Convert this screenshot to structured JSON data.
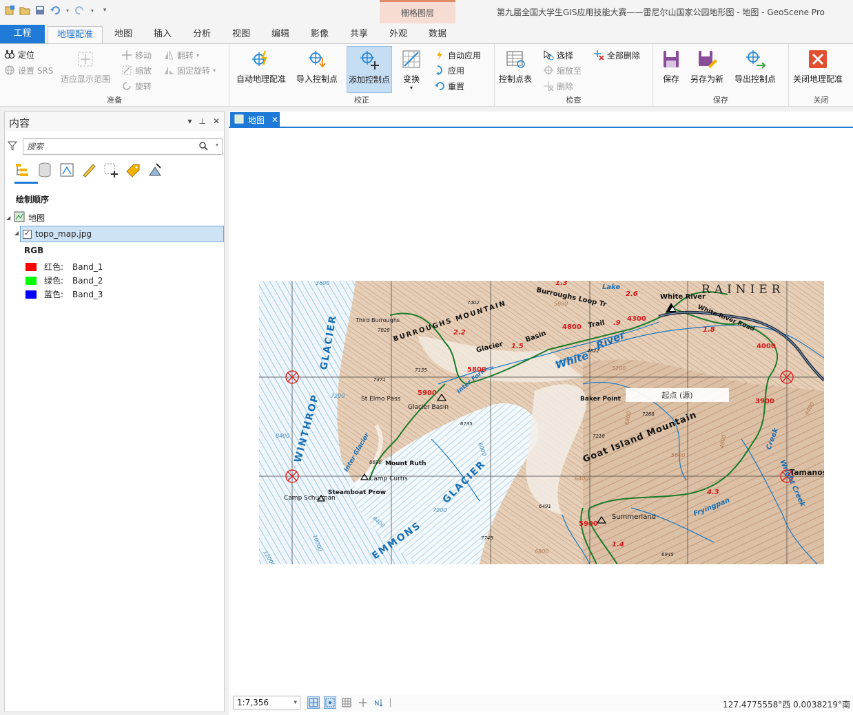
{
  "titlebar": {
    "app_title": "第九届全国大学生GIS应用技能大赛——雷尼尔山国家公园地形图 - 地图 - GeoScene Pro",
    "context_tab": "栅格图层"
  },
  "tabs": [
    {
      "label": "工程"
    },
    {
      "label": "地理配准"
    },
    {
      "label": "地图"
    },
    {
      "label": "插入"
    },
    {
      "label": "分析"
    },
    {
      "label": "视图"
    },
    {
      "label": "编辑"
    },
    {
      "label": "影像"
    },
    {
      "label": "共享"
    },
    {
      "label": "外观"
    },
    {
      "label": "数据"
    }
  ],
  "ribbon": {
    "prepare": {
      "label": "准备",
      "locate": "定位",
      "set_srs": "设置 SRS",
      "fit_extent": "适应显示范围",
      "move": "移动",
      "scale": "缩放",
      "rotate": "旋转",
      "flip": "翻转",
      "fixed_rotate": "固定旋转"
    },
    "adjust": {
      "label": "校正",
      "auto_georef": "自动地理配准",
      "import_cp": "导入控制点",
      "add_cp": "添加控制点",
      "transform": "变换",
      "auto_apply": "自动应用",
      "apply": "应用",
      "reset": "重置"
    },
    "review": {
      "label": "检查",
      "cp_table": "控制点表",
      "select": "选择",
      "zoom_to": "缩放至",
      "delete": "删除",
      "delete_all": "全部删除"
    },
    "save": {
      "label": "保存",
      "save": "保存",
      "save_as": "另存为新",
      "export_cp": "导出控制点"
    },
    "close": {
      "label": "关闭",
      "close_georef": "关闭地理配准"
    }
  },
  "contents": {
    "title": "内容",
    "search_placeholder": "搜索",
    "draw_order": "绘制顺序",
    "map_name": "地图",
    "layer_name": "topo_map.jpg",
    "renderer": "RGB",
    "bands": [
      {
        "channel": "红色:",
        "band": "Band_1",
        "color": "#ff0000"
      },
      {
        "channel": "绿色:",
        "band": "Band_2",
        "color": "#00ff00"
      },
      {
        "channel": "蓝色:",
        "band": "Band_3",
        "color": "#0000ff"
      }
    ]
  },
  "mapview": {
    "tab_label": "地图",
    "scale": "1:7,356",
    "coords": "127.4775558°西 0.0038219°南",
    "map_labels": {
      "rainier": "RAINIER",
      "white_river": "White River",
      "white_river_road": "White River Road",
      "burroughs_mountain": "BURROUGHS MOUNTAIN",
      "glacier_basin_trail": "Glacier Basin Trail",
      "burroughs_loop": "Burroughs Loop Tr",
      "winthrop": "WINTHROP",
      "glacier": "GLACIER",
      "emmons": "EMMONS",
      "emmons_glacier": "GLACIER",
      "goat_island": "Goat Island Mountain",
      "baker_point": "Baker Point",
      "white": "White",
      "river": "River",
      "inter_fork": "Inter Fork",
      "inter_glacier": "Inter Glacier",
      "st_elmo": "St Elmo Pass",
      "glacier_basin": "Glacier Basin",
      "mount_ruth": "Mount Ruth",
      "camp_curtis": "Camp Curtis",
      "steamboat_prow": "Steamboat Prow",
      "camp_schurman": "Camp Schurman",
      "summerland": "Summerland",
      "fryingpan": "Fryingpan",
      "creek": "Creek",
      "wright_creek": "Wright Creek",
      "tamanos": "Tamanos Mt",
      "third_burroughs": "Third Burroughs",
      "lake": "Lake",
      "trail": "Trail",
      "basin": "Basin",
      "glacier_word": "Glacier",
      "source_label": "起点 (源)",
      "elev_5900": "5900",
      "elev_4800": "4800",
      "elev_4300": "4300",
      "elev_4000": "4000",
      "elev_3900": "3900",
      "elev_5800": "5800",
      "elev_5900b": "5900",
      "dist_2_2": "2.2",
      "dist_1_5": "1.5",
      "dist_2_6": "2.6",
      "dist_1_8": "1.8",
      "dist_4_3": "4.3",
      "dist_1_4": "1.4",
      "dist_1_3": "1.3",
      "dist_0_9": ".9",
      "spot_7828": "7828",
      "spot_7402": "7402",
      "spot_7135": "7135",
      "spot_7371": "7371",
      "spot_6735": "6735",
      "spot_7288": "7288",
      "spot_7218": "7218",
      "spot_6491": "6491",
      "spot_6945": "6945",
      "spot_7745": "7745",
      "spot_4822": "4822",
      "spot_8690": "8690",
      "c_7200": "7200",
      "c_8400": "8400",
      "c_10000": "10000",
      "c_12000": "12000",
      "c_7200b": "7200",
      "c_8400b": "8400",
      "c_6000": "6000",
      "c_5200": "5200",
      "c_6800": "6800",
      "c_5600": "5600",
      "c_4800": "4800",
      "c_4400": "4400",
      "c_6400": "6400",
      "c_6800b": "6800",
      "c_5600b": "5600",
      "c_3600": "3600"
    }
  }
}
